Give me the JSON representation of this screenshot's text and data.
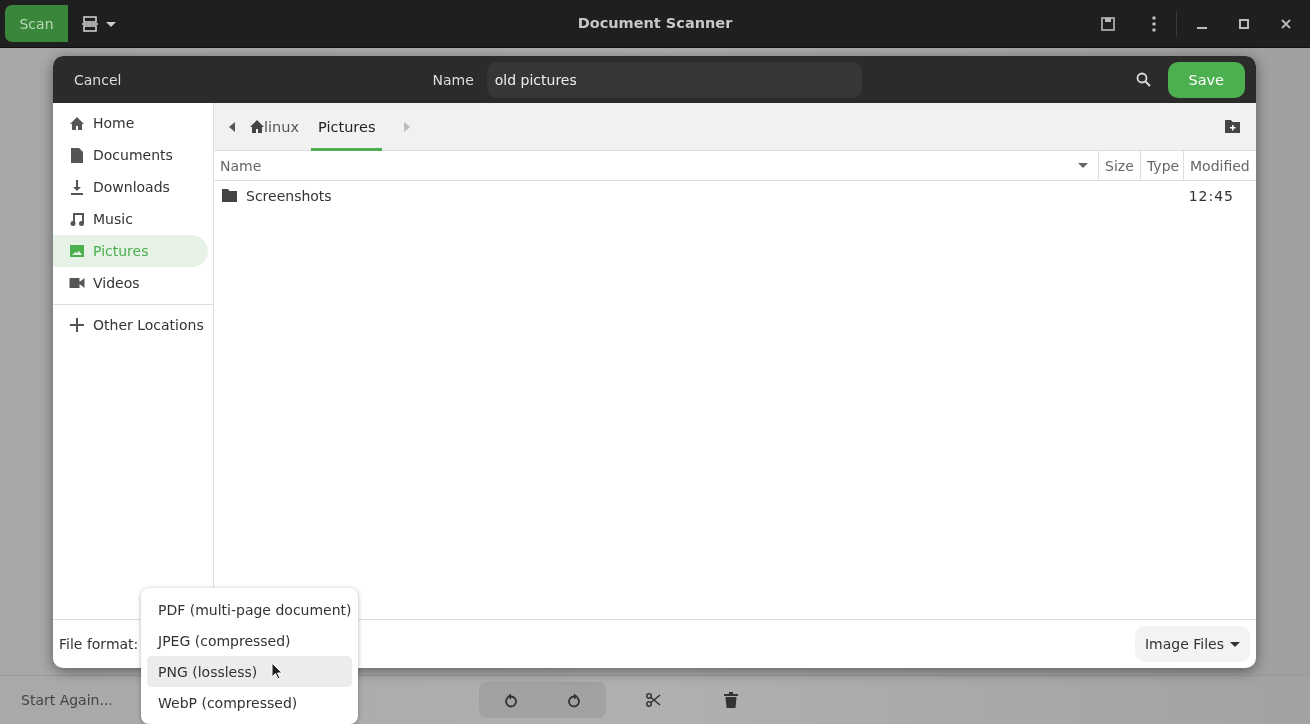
{
  "app": {
    "scan_button": "Scan",
    "title": "Document Scanner",
    "start_again": "Start Again..."
  },
  "dialog": {
    "cancel": "Cancel",
    "name_label": "Name",
    "name_value": "old pictures",
    "save": "Save",
    "places": [
      {
        "label": "Home",
        "kind": "home",
        "selected": false
      },
      {
        "label": "Documents",
        "kind": "document",
        "selected": false
      },
      {
        "label": "Downloads",
        "kind": "download",
        "selected": false
      },
      {
        "label": "Music",
        "kind": "music",
        "selected": false
      },
      {
        "label": "Pictures",
        "kind": "picture",
        "selected": true
      },
      {
        "label": "Videos",
        "kind": "video",
        "selected": false
      }
    ],
    "other_locations": "Other Locations",
    "path": [
      {
        "label": "linux",
        "kind": "home",
        "selected": false
      },
      {
        "label": "Pictures",
        "kind": "folder",
        "selected": true
      }
    ],
    "columns": [
      "Name",
      "Size",
      "Type",
      "Modified"
    ],
    "rows": [
      {
        "name": "Screenshots",
        "modified": "12:45"
      }
    ],
    "file_format_label": "File format:",
    "filter": "Image Files"
  },
  "format_menu": [
    {
      "label": "PDF (multi-page document)",
      "selected": false
    },
    {
      "label": "JPEG (compressed)",
      "selected": false
    },
    {
      "label": "PNG (lossless)",
      "selected": true
    },
    {
      "label": "WebP (compressed)",
      "selected": false
    }
  ]
}
